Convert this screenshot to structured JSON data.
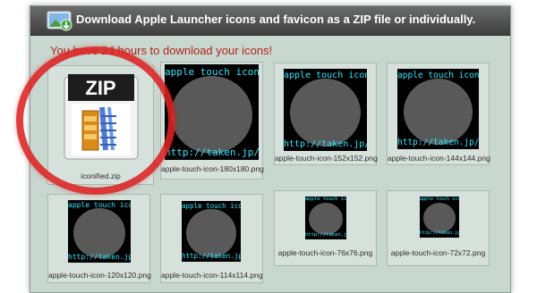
{
  "header": {
    "title": "Download Apple Launcher icons and favicon as a ZIP file or individually.",
    "icon": "download-image-icon"
  },
  "notice": "You have 24 hours to download your icons!",
  "zip": {
    "badge": "ZIP",
    "filename": "iconified.zip",
    "icon": "zip-archive-icon"
  },
  "thumb_text": {
    "top": "apple touch icon",
    "bottom": "http://taken.jp/"
  },
  "tiles": [
    {
      "filename": "apple-touch-icon-180x180.png"
    },
    {
      "filename": "apple-touch-icon-152x152.png"
    },
    {
      "filename": "apple-touch-icon-144x144.png"
    },
    {
      "filename": "apple-touch-icon-120x120.png"
    },
    {
      "filename": "apple-touch-icon-114x114.png"
    },
    {
      "filename": "apple-touch-icon-76x76.png"
    },
    {
      "filename": "apple-touch-icon-72x72.png"
    }
  ],
  "colors": {
    "annotation_circle": "#dc2323",
    "link_text": "#2ee6ff",
    "notice": "#b3261e"
  }
}
